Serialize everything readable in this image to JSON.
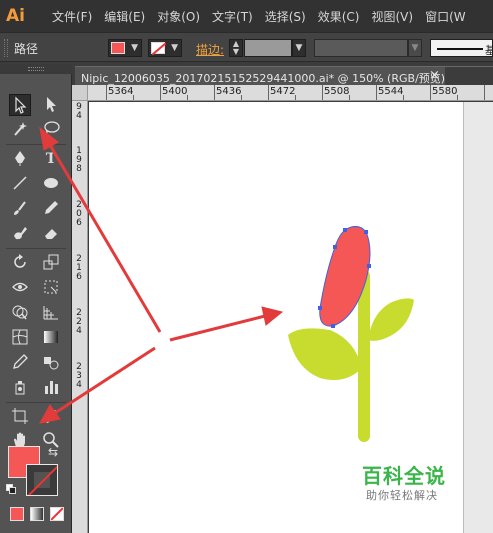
{
  "app": {
    "logo": "Ai"
  },
  "menu": [
    "文件(F)",
    "编辑(E)",
    "对象(O)",
    "文字(T)",
    "选择(S)",
    "效果(C)",
    "视图(V)",
    "窗口(W"
  ],
  "control_bar": {
    "selection_label": "路径",
    "fill_color": "#f55656",
    "stroke_label": "描边:",
    "stroke_value": "",
    "brush_label": "基"
  },
  "document": {
    "tab_title": "Nipic_12006035_20170215152529441000.ai* @ 150% (RGB/预览)",
    "close_glyph": "×"
  },
  "ruler": {
    "horizontal": [
      "5364",
      "5400",
      "5436",
      "5472",
      "5508",
      "5544",
      "5580"
    ],
    "vertical": [
      "94",
      "198",
      "206",
      "216",
      "224",
      "234"
    ]
  },
  "artwork": {
    "petal_color": "#f55656",
    "stem_color": "#c7dc2f",
    "selection_color": "#3f62e0",
    "arrow_color": "#e23b3b"
  },
  "toolbar": {
    "fill_color": "#f55656",
    "swap_glyph": "⇆"
  },
  "watermark": {
    "title": "百科全说",
    "subtitle": "助你轻松解决"
  }
}
